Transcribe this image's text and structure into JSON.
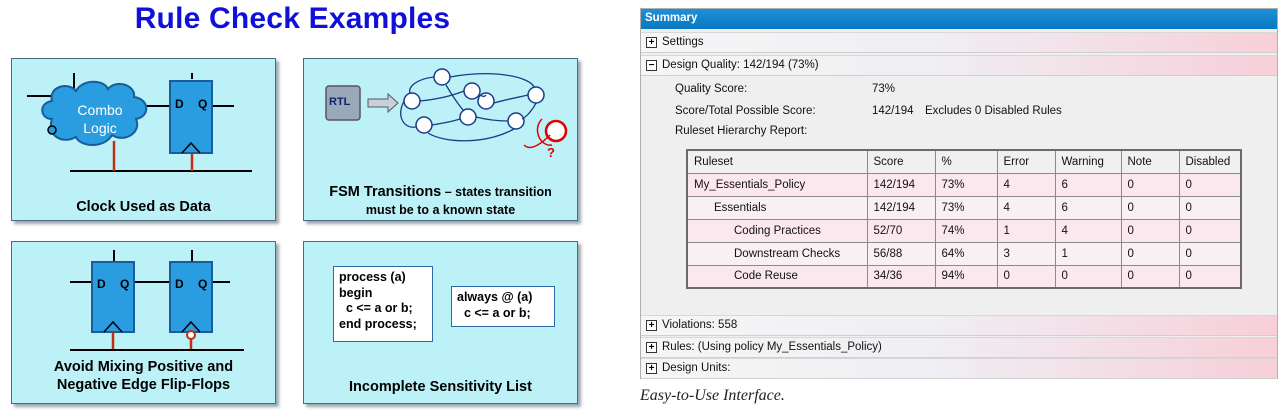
{
  "left": {
    "title": "Rule Check Examples",
    "panel1": {
      "cloud_line1": "Combo",
      "cloud_line2": "Logic",
      "ff_d": "D",
      "ff_q": "Q",
      "caption": "Clock Used as Data"
    },
    "panel2": {
      "rtl": "RTL",
      "question": "?",
      "caption_bold": "FSM Transitions",
      "caption_rest": " – states transition",
      "caption_line2": "must be to a known state"
    },
    "panel3": {
      "ff_d": "D",
      "ff_q": "Q",
      "caption_line1": "Avoid Mixing Positive and",
      "caption_line2": "Negative Edge Flip-Flops"
    },
    "panel4": {
      "code1": "process (a)\nbegin\n  c <= a or b;\nend process;",
      "code2": "always @ (a)\n  c <= a or b;",
      "caption": "Incomplete Sensitivity List"
    }
  },
  "summary": {
    "header": "Summary",
    "settings": "Settings",
    "design_quality": "Design Quality:  142/194  (73%)",
    "quality_score_label": "Quality Score:",
    "quality_score_value": "73%",
    "total_label": "Score/Total Possible Score:",
    "total_value": "142/194",
    "excludes": "Excludes 0 Disabled Rules",
    "hierarchy_label": "Ruleset Hierarchy Report:",
    "table": {
      "headers": [
        "Ruleset",
        "Score",
        "%",
        "Error",
        "Warning",
        "Note",
        "Disabled"
      ],
      "rows": [
        [
          "My_Essentials_Policy",
          "142/194",
          "73%",
          "4",
          "6",
          "0",
          "0"
        ],
        [
          "Essentials",
          "142/194",
          "73%",
          "4",
          "6",
          "0",
          "0"
        ],
        [
          "Coding Practices",
          "52/70",
          "74%",
          "1",
          "4",
          "0",
          "0"
        ],
        [
          "Downstream Checks",
          "56/88",
          "64%",
          "3",
          "1",
          "0",
          "0"
        ],
        [
          "Code Reuse",
          "34/36",
          "94%",
          "0",
          "0",
          "0",
          "0"
        ]
      ]
    },
    "violations": "Violations:  558",
    "rules": "Rules:  (Using policy My_Essentials_Policy)",
    "design_units": "Design Units:",
    "plus_sign": "+",
    "minus_sign": "−"
  },
  "caption": "Easy-to-Use Interface."
}
